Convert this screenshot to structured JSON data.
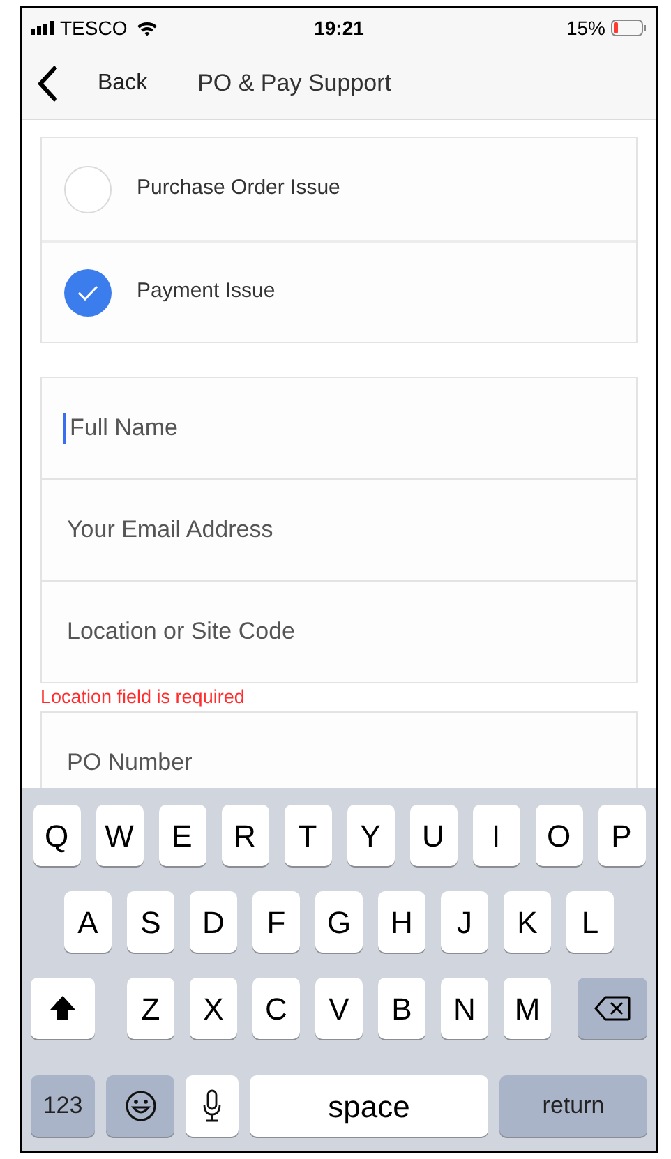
{
  "status_bar": {
    "carrier": "TESCO",
    "time": "19:21",
    "battery": "15%"
  },
  "nav": {
    "back": "Back",
    "title": "PO & Pay Support"
  },
  "issue_options": [
    {
      "label": "Purchase Order Issue",
      "selected": false
    },
    {
      "label": "Payment Issue",
      "selected": true
    }
  ],
  "fields": [
    {
      "placeholder": "Full Name",
      "focused": true
    },
    {
      "placeholder": "Your Email Address",
      "focused": false
    },
    {
      "placeholder": "Location or Site Code",
      "focused": false
    }
  ],
  "error": "Location field is required",
  "po_field": {
    "placeholder": "PO Number"
  },
  "keyboard": {
    "rows": [
      [
        "Q",
        "W",
        "E",
        "R",
        "T",
        "Y",
        "U",
        "I",
        "O",
        "P"
      ],
      [
        "A",
        "S",
        "D",
        "F",
        "G",
        "H",
        "J",
        "K",
        "L"
      ],
      [
        "Z",
        "X",
        "C",
        "V",
        "B",
        "N",
        "M"
      ]
    ],
    "numbers_key": "123",
    "space_key": "space",
    "return_key": "return"
  }
}
